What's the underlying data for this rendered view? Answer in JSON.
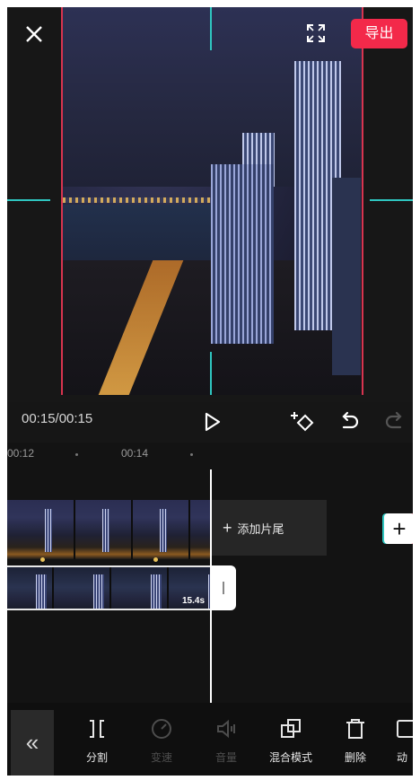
{
  "header": {
    "export_label": "导出"
  },
  "player": {
    "timecode": "00:15/00:15"
  },
  "timeline": {
    "ruler": [
      "00:12",
      "00:14"
    ],
    "add_ending_label": "添加片尾",
    "clip_duration": "15.4s"
  },
  "toolbar": {
    "items": [
      {
        "label": "分割",
        "icon": "split-icon",
        "enabled": true
      },
      {
        "label": "变速",
        "icon": "speed-icon",
        "enabled": false
      },
      {
        "label": "音量",
        "icon": "volume-icon",
        "enabled": false
      },
      {
        "label": "混合模式",
        "icon": "blend-mode-icon",
        "enabled": true
      },
      {
        "label": "删除",
        "icon": "delete-icon",
        "enabled": true
      },
      {
        "label": "动",
        "icon": "animation-icon",
        "enabled": true
      }
    ]
  },
  "colors": {
    "accent": "#f3294a",
    "guide": "#2fc6c0",
    "background": "#161616"
  }
}
